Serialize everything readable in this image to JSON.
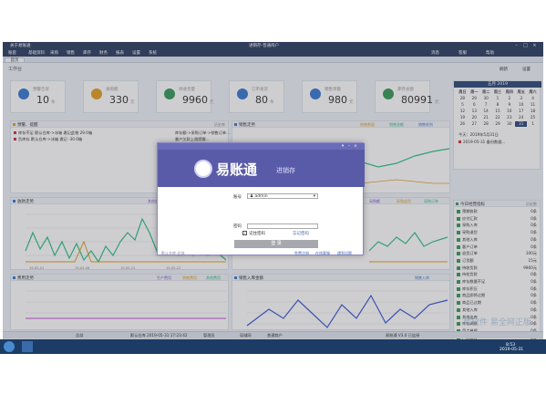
{
  "app": {
    "title_left": "关于易账通",
    "title_center": "进销存-普通商户",
    "menu": [
      "账套",
      "基础资料",
      "采购",
      "销售",
      "库存",
      "财务",
      "报表",
      "设置",
      "系统"
    ],
    "menu_right": [
      "消息",
      "客服",
      "帮助"
    ]
  },
  "tab": {
    "label": "首页"
  },
  "workbench": {
    "title": "工作台",
    "refresh_label": "刷新",
    "settings_label": "设置"
  },
  "cards": [
    {
      "label": "预警告诉",
      "value": "10",
      "unit": "条",
      "color": "#3a7ad0"
    },
    {
      "label": "采购额",
      "value": "330",
      "unit": "元",
      "color": "#e0a020"
    },
    {
      "label": "待收货量",
      "value": "9960",
      "unit": "元",
      "color": "#3a9a5a"
    },
    {
      "label": "订单发货",
      "value": "80",
      "unit": "条",
      "color": "#3a7ad0"
    },
    {
      "label": "销售单额",
      "value": "980",
      "unit": "元",
      "color": "#3a7ad0"
    },
    {
      "label": "库存总额",
      "value": "80991",
      "unit": "元",
      "color": "#3a9a5a"
    }
  ],
  "alerts": {
    "title": "预警、提醒",
    "action": "历史库",
    "rows": [
      "库存不足  默认仓库->冰箱 邀记此物 29.0箱",
      "负库存  默认仓库->冰箱 邀记 -30.0箱"
    ],
    "right_rows": [
      "库存额->采购订单->销售订单...",
      "曼户欠款上限提醒..."
    ]
  },
  "sales_trend": {
    "title": "销售走势",
    "legend": [
      "销售数量",
      "销售金额",
      "销售毛利"
    ]
  },
  "receipt_trend": {
    "title": "收款走势",
    "legend": [
      "其他收款",
      "采购退货",
      "应收款项",
      "其他收款"
    ]
  },
  "purchase_trend": {
    "title": "采购走势",
    "legend": [
      "采购额",
      "采购退货",
      "采购订单"
    ]
  },
  "expense_trend": {
    "title": "费用走势",
    "legend": [
      "生产费用",
      "销售费用",
      "其他费用"
    ]
  },
  "stock_trend": {
    "title": "销售入库金额",
    "legend": [
      "销售入库"
    ]
  },
  "calendar": {
    "month_label": "五月 2019",
    "weekdays": [
      "周日",
      "周一",
      "周二",
      "周三",
      "周四",
      "周五",
      "周六"
    ],
    "days": [
      "28",
      "29",
      "30",
      "1",
      "2",
      "3",
      "4",
      "5",
      "6",
      "7",
      "8",
      "9",
      "10",
      "11",
      "12",
      "13",
      "14",
      "15",
      "16",
      "17",
      "18",
      "19",
      "20",
      "21",
      "22",
      "23",
      "24",
      "25",
      "26",
      "27",
      "28",
      "29",
      "30",
      "31",
      "1"
    ],
    "today_index": 33,
    "note": "2019-05-31 备份数据...",
    "header_note": "今天：2019年5月31日"
  },
  "business": {
    "title": "今日经营指标",
    "action": "历史数",
    "rows": [
      {
        "label": "预期收款",
        "value": "0条"
      },
      {
        "label": "应付汇款",
        "value": "0条"
      },
      {
        "label": "采购入库",
        "value": "0条"
      },
      {
        "label": "采购退货",
        "value": "0条"
      },
      {
        "label": "其他入库",
        "value": "0条"
      },
      {
        "label": "客户订单",
        "value": "0条"
      },
      {
        "label": "退货订单",
        "value": "100元"
      },
      {
        "label": "订货额",
        "value": "15元"
      },
      {
        "label": "待收货款",
        "value": "9960元"
      },
      {
        "label": "待检货款",
        "value": "0条"
      },
      {
        "label": "库存数量不足",
        "value": "0条"
      },
      {
        "label": "库存积压",
        "value": "0条"
      },
      {
        "label": "商品即将过期",
        "value": "0条"
      },
      {
        "label": "商品已过期",
        "value": "0条"
      },
      {
        "label": "其他入库",
        "value": "0条"
      },
      {
        "label": "其他出库",
        "value": "0条"
      },
      {
        "label": "库存调拨",
        "value": "0条"
      },
      {
        "label": "盘点单据",
        "value": "0条"
      },
      {
        "label": "产品组装",
        "value": "0条"
      },
      {
        "label": "库存变化",
        "value": "0条"
      }
    ]
  },
  "login": {
    "brand": "易账通",
    "brand_sub": "进销存",
    "account_label": "账号",
    "account_value": "admin",
    "password_label": "密码",
    "remember_label": "记住密码",
    "reset_label": "忘记密码",
    "login_button": "登 录",
    "footer_left": "默认仓库-总部",
    "footer_links": [
      "免费注册",
      "在线客服",
      "遇到问题"
    ]
  },
  "statusbar": {
    "items": [
      "总部",
      "默认仓库 2019-05-31 17:23:42",
      "管理员",
      "局域网",
      "普通商户"
    ],
    "right": "易账通 V3.0 已连接"
  },
  "taskbar": {
    "time": "8:53",
    "date": "2019-05-31"
  },
  "watermark": "易软件 易全网正版"
}
